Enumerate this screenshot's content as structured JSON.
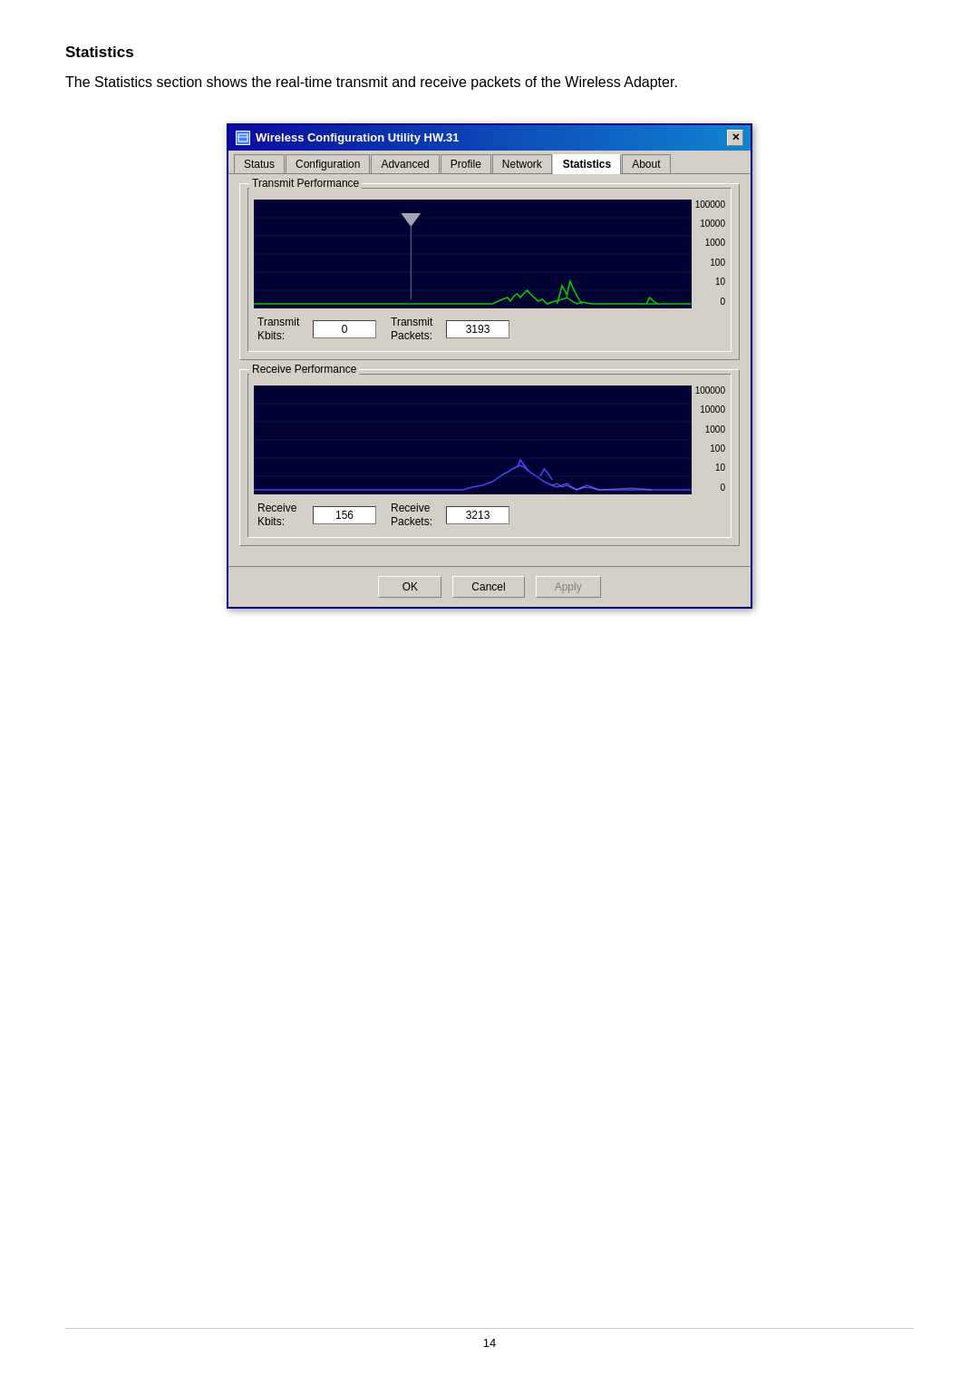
{
  "page": {
    "section_title": "Statistics",
    "section_desc": "The Statistics section shows the real-time transmit and receive packets of the Wireless Adapter.",
    "page_number": "14"
  },
  "dialog": {
    "title": "Wireless Configuration Utility HW.31",
    "close_btn": "✕",
    "tabs": [
      {
        "label": "Status",
        "active": false
      },
      {
        "label": "Configuration",
        "active": false
      },
      {
        "label": "Advanced",
        "active": false
      },
      {
        "label": "Profile",
        "active": false
      },
      {
        "label": "Network",
        "active": false
      },
      {
        "label": "Statistics",
        "active": true
      },
      {
        "label": "About",
        "active": false
      }
    ],
    "transmit_section": {
      "label": "Transmit Performance",
      "y_axis": [
        "100000",
        "10000",
        "1000",
        "100",
        "10",
        "0"
      ],
      "transmit_kbits_label": "Transmit\nKbits:",
      "transmit_kbits_value": "0",
      "transmit_packets_label": "Transmit\nPackets:",
      "transmit_packets_value": "3193"
    },
    "receive_section": {
      "label": "Receive Performance",
      "y_axis": [
        "100000",
        "10000",
        "1000",
        "100",
        "10",
        "0"
      ],
      "receive_kbits_label": "Receive\nKbits:",
      "receive_kbits_value": "156",
      "receive_packets_label": "Receive\nPackets:",
      "receive_packets_value": "3213"
    },
    "buttons": {
      "ok": "OK",
      "cancel": "Cancel",
      "apply": "Apply"
    }
  }
}
